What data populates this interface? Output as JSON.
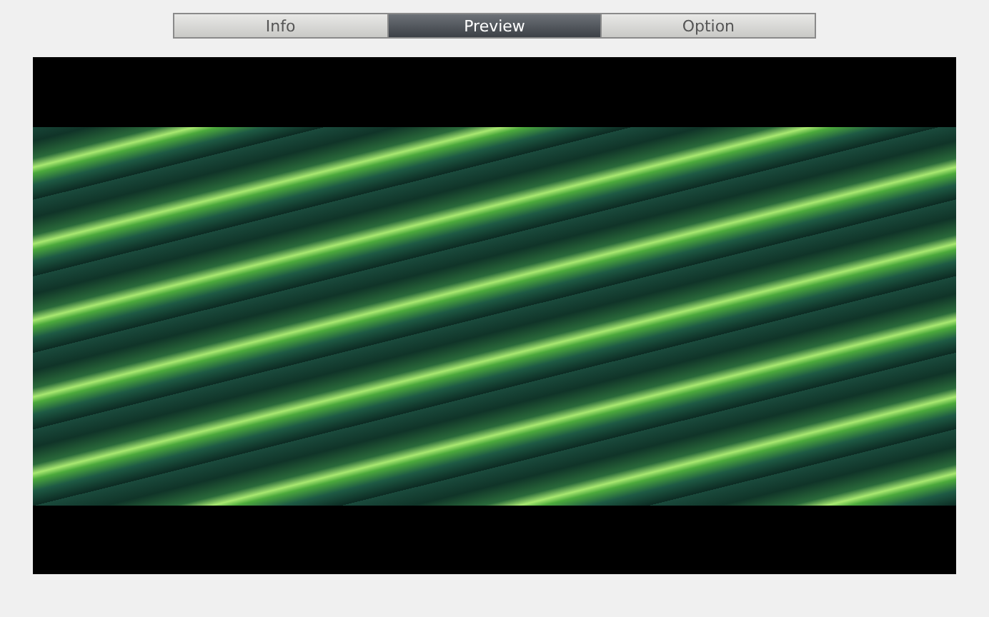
{
  "tabs": [
    {
      "label": "Info",
      "selected": false
    },
    {
      "label": "Preview",
      "selected": true
    },
    {
      "label": "Option",
      "selected": false
    }
  ]
}
